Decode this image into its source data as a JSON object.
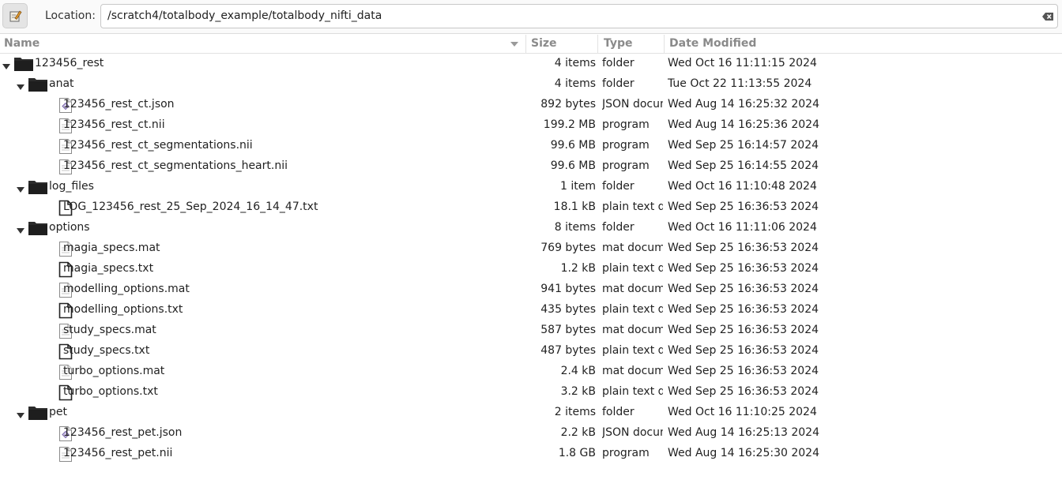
{
  "location": {
    "label": "Location:",
    "value": "/scratch4/totalbody_example/totalbody_nifti_data"
  },
  "columns": {
    "name": "Name",
    "size": "Size",
    "type": "Type",
    "modified": "Date Modified"
  },
  "rows": [
    {
      "name": "123456_rest",
      "size": "4 items",
      "type": "folder",
      "date": "Wed Oct 16 11:11:15 2024",
      "kind": "folder",
      "depth": 0,
      "expanded": true
    },
    {
      "name": "anat",
      "size": "4 items",
      "type": "folder",
      "date": "Tue Oct 22 11:13:55 2024",
      "kind": "folder",
      "depth": 1,
      "expanded": true
    },
    {
      "name": "123456_rest_ct.json",
      "size": "892 bytes",
      "type": "JSON document",
      "date": "Wed Aug 14 16:25:32 2024",
      "kind": "json",
      "depth": 2
    },
    {
      "name": "123456_rest_ct.nii",
      "size": "199.2 MB",
      "type": "program",
      "date": "Wed Aug 14 16:25:36 2024",
      "kind": "binary",
      "depth": 2
    },
    {
      "name": "123456_rest_ct_segmentations.nii",
      "size": "99.6 MB",
      "type": "program",
      "date": "Wed Sep 25 16:14:57 2024",
      "kind": "binary",
      "depth": 2
    },
    {
      "name": "123456_rest_ct_segmentations_heart.nii",
      "size": "99.6 MB",
      "type": "program",
      "date": "Wed Sep 25 16:14:55 2024",
      "kind": "binary",
      "depth": 2
    },
    {
      "name": "log_files",
      "size": "1 item",
      "type": "folder",
      "date": "Wed Oct 16 11:10:48 2024",
      "kind": "folder",
      "depth": 1,
      "expanded": true
    },
    {
      "name": "LOG_123456_rest_25_Sep_2024_16_14_47.txt",
      "size": "18.1 kB",
      "type": "plain text document",
      "date": "Wed Sep 25 16:36:53 2024",
      "kind": "text",
      "depth": 2
    },
    {
      "name": "options",
      "size": "8 items",
      "type": "folder",
      "date": "Wed Oct 16 11:11:06 2024",
      "kind": "folder",
      "depth": 1,
      "expanded": true
    },
    {
      "name": "magia_specs.mat",
      "size": "769 bytes",
      "type": "mat document",
      "date": "Wed Sep 25 16:36:53 2024",
      "kind": "binary",
      "depth": 2
    },
    {
      "name": "magia_specs.txt",
      "size": "1.2 kB",
      "type": "plain text document",
      "date": "Wed Sep 25 16:36:53 2024",
      "kind": "text",
      "depth": 2
    },
    {
      "name": "modelling_options.mat",
      "size": "941 bytes",
      "type": "mat document",
      "date": "Wed Sep 25 16:36:53 2024",
      "kind": "binary",
      "depth": 2
    },
    {
      "name": "modelling_options.txt",
      "size": "435 bytes",
      "type": "plain text document",
      "date": "Wed Sep 25 16:36:53 2024",
      "kind": "text",
      "depth": 2
    },
    {
      "name": "study_specs.mat",
      "size": "587 bytes",
      "type": "mat document",
      "date": "Wed Sep 25 16:36:53 2024",
      "kind": "binary",
      "depth": 2
    },
    {
      "name": "study_specs.txt",
      "size": "487 bytes",
      "type": "plain text document",
      "date": "Wed Sep 25 16:36:53 2024",
      "kind": "text",
      "depth": 2
    },
    {
      "name": "turbo_options.mat",
      "size": "2.4 kB",
      "type": "mat document",
      "date": "Wed Sep 25 16:36:53 2024",
      "kind": "binary",
      "depth": 2
    },
    {
      "name": "turbo_options.txt",
      "size": "3.2 kB",
      "type": "plain text document",
      "date": "Wed Sep 25 16:36:53 2024",
      "kind": "text",
      "depth": 2
    },
    {
      "name": "pet",
      "size": "2 items",
      "type": "folder",
      "date": "Wed Oct 16 11:10:25 2024",
      "kind": "folder",
      "depth": 1,
      "expanded": true
    },
    {
      "name": "123456_rest_pet.json",
      "size": "2.2 kB",
      "type": "JSON document",
      "date": "Wed Aug 14 16:25:13 2024",
      "kind": "json",
      "depth": 2
    },
    {
      "name": "123456_rest_pet.nii",
      "size": "1.8 GB",
      "type": "program",
      "date": "Wed Aug 14 16:25:30 2024",
      "kind": "binary",
      "depth": 2
    }
  ]
}
